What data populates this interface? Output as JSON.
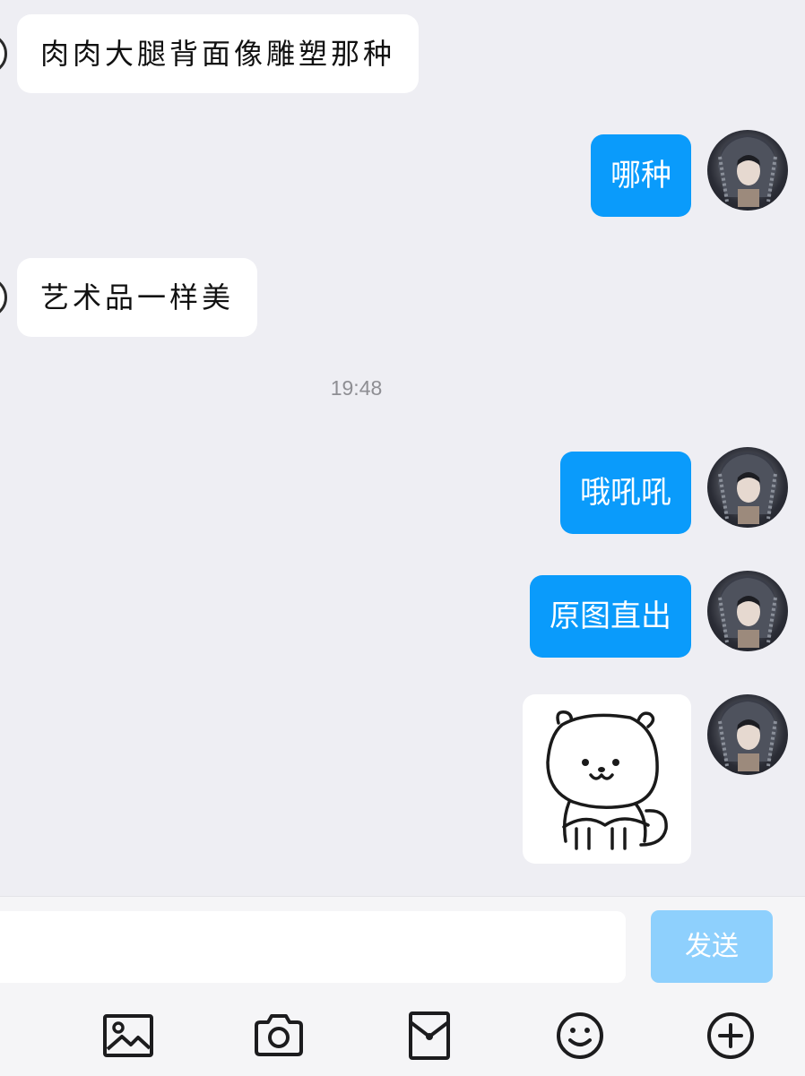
{
  "messages": {
    "incoming": [
      {
        "text": "肉肉大腿背面像雕塑那种"
      },
      {
        "text": "艺术品一样美"
      }
    ],
    "outgoing": [
      {
        "text": "哪种"
      },
      {
        "text": "哦吼吼"
      },
      {
        "text": "原图直出"
      }
    ],
    "timestamp": "19:48",
    "sticker": {
      "icon": "bear-sticker"
    }
  },
  "composer": {
    "input_value": "",
    "send_label": "发送"
  },
  "toolbar": {
    "icons": [
      "image-icon",
      "camera-icon",
      "red-packet-icon",
      "emoji-icon",
      "plus-icon"
    ]
  },
  "colors": {
    "background": "#eeeef3",
    "outgoing_bubble": "#0a9bfb",
    "incoming_bubble": "#ffffff",
    "send_button_disabled": "#8ed0fd",
    "timestamp": "#8e8e93"
  }
}
